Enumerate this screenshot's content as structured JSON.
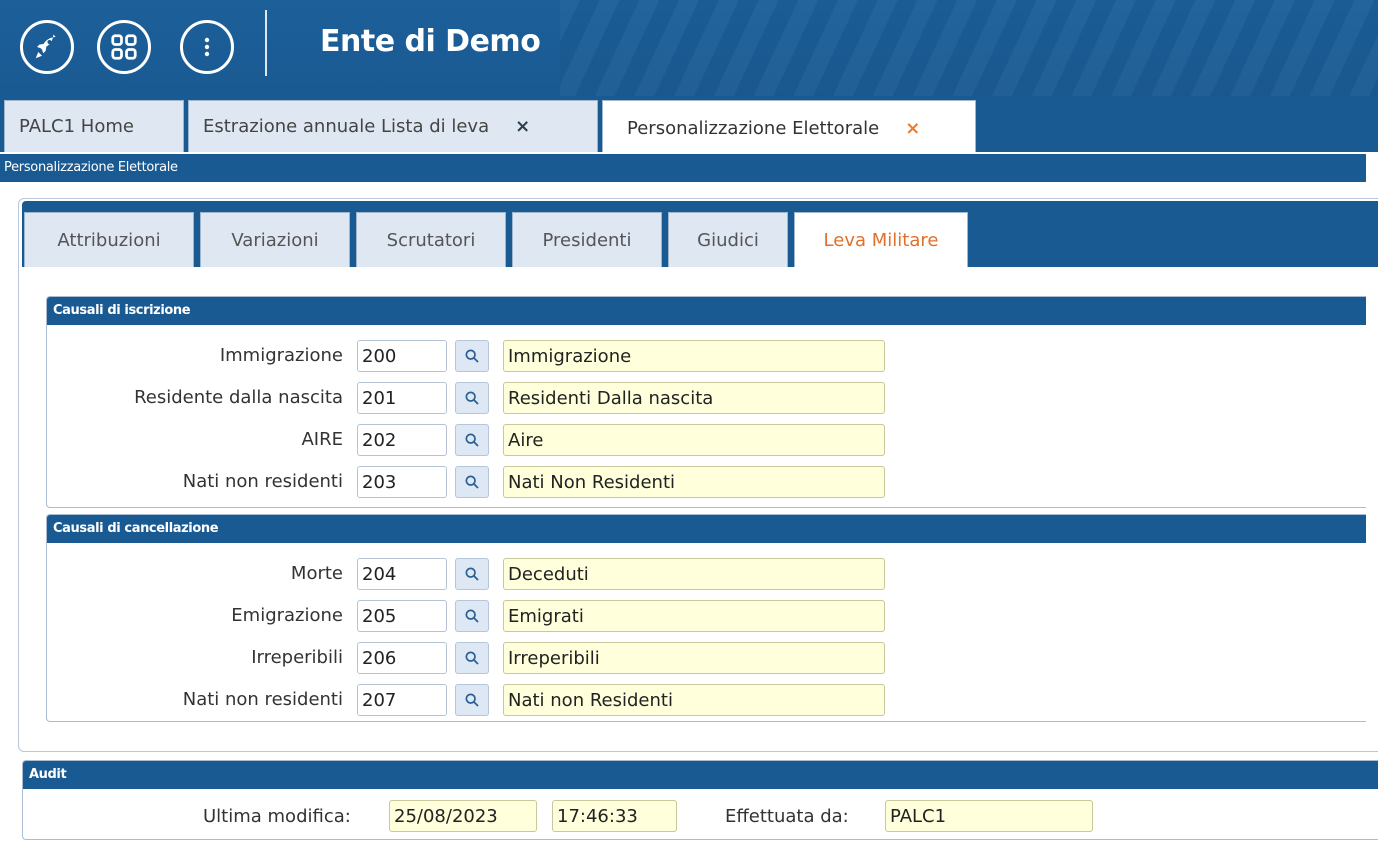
{
  "app": {
    "title": "Ente di Demo"
  },
  "header_icons": [
    "rocket-icon",
    "apps-grid-icon",
    "more-vertical-icon"
  ],
  "tabs": [
    {
      "label": "PALC1 Home",
      "closable": false,
      "active": false
    },
    {
      "label": "Estrazione annuale Lista di leva",
      "closable": true,
      "active": false
    },
    {
      "label": "Personalizzazione Elettorale",
      "closable": true,
      "active": true
    }
  ],
  "close_glyph": "×",
  "breadcrumb": "Personalizzazione Elettorale",
  "subtabs": [
    {
      "label": "Attribuzioni",
      "active": false
    },
    {
      "label": "Variazioni",
      "active": false
    },
    {
      "label": "Scrutatori",
      "active": false
    },
    {
      "label": "Presidenti",
      "active": false
    },
    {
      "label": "Giudici",
      "active": false
    },
    {
      "label": "Leva Militare",
      "active": true
    }
  ],
  "iscrizione": {
    "title": "Causali di iscrizione",
    "rows": [
      {
        "label": "Immigrazione",
        "code": "200",
        "description": "Immigrazione"
      },
      {
        "label": "Residente dalla nascita",
        "code": "201",
        "description": "Residenti Dalla nascita"
      },
      {
        "label": "AIRE",
        "code": "202",
        "description": "Aire"
      },
      {
        "label": "Nati non residenti",
        "code": "203",
        "description": "Nati Non Residenti"
      }
    ]
  },
  "cancellazione": {
    "title": "Causali di cancellazione",
    "rows": [
      {
        "label": "Morte",
        "code": "204",
        "description": "Deceduti"
      },
      {
        "label": "Emigrazione",
        "code": "205",
        "description": "Emigrati"
      },
      {
        "label": "Irreperibili",
        "code": "206",
        "description": "Irreperibili"
      },
      {
        "label": "Nati non residenti",
        "code": "207",
        "description": "Nati non Residenti"
      }
    ]
  },
  "audit": {
    "title": "Audit",
    "last_modified_label": "Ultima modifica:",
    "date": "25/08/2023",
    "time": "17:46:33",
    "done_by_label": "Effettuata da:",
    "user": "PALC1"
  },
  "colors": {
    "header": "#1a5a93",
    "active_subtab_text": "#e0702b",
    "readonly_field": "#ffffdc"
  }
}
